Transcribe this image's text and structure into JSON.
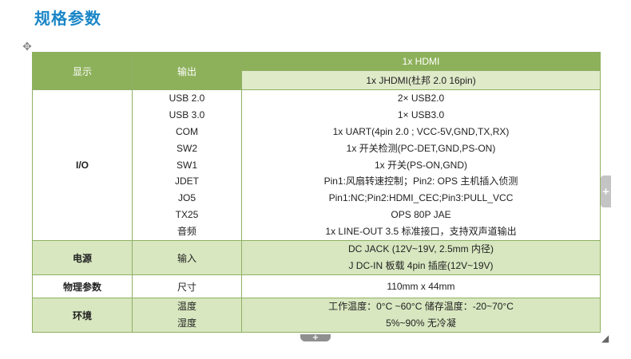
{
  "page_title": "规格参数",
  "table": {
    "display": {
      "label": "显示",
      "sub": "输出",
      "values": [
        "1x HDMI",
        "1x JHDMI(杜邦 2.0 16pin)"
      ]
    },
    "io": {
      "label": "I/O",
      "rows": [
        {
          "name": "USB 2.0",
          "value": "2× USB2.0"
        },
        {
          "name": "USB 3.0",
          "value": "1× USB3.0"
        },
        {
          "name": "COM",
          "value": "1x UART(4pin 2.0 ; VCC-5V,GND,TX,RX)"
        },
        {
          "name": "SW2",
          "value": "1x 开关检测(PC-DET,GND,PS-ON)"
        },
        {
          "name": "SW1",
          "value": "1x 开关(PS-ON,GND)"
        },
        {
          "name": "JDET",
          "value": "Pin1:风扇转速控制；Pin2: OPS 主机插入侦测"
        },
        {
          "name": "JO5",
          "value": "Pin1:NC;Pin2:HDMI_CEC;Pin3:PULL_VCC"
        },
        {
          "name": "TX25",
          "value": "OPS 80P JAE"
        },
        {
          "name": "音频",
          "value": "1x LINE-OUT 3.5 标准接口，支持双声道输出"
        }
      ]
    },
    "power": {
      "label": "电源",
      "sub": "输入",
      "values": [
        "DC JACK (12V~19V, 2.5mm 内径)",
        "J DC-IN 板载 4pin 插座(12V~19V)"
      ]
    },
    "physical": {
      "label": "物理参数",
      "sub": "尺寸",
      "value": "110mm x 44mm"
    },
    "environment": {
      "label": "环境",
      "rows": [
        {
          "name": "温度",
          "value": "工作温度：0°C ~60°C 储存温度：-20~70°C"
        },
        {
          "name": "湿度",
          "value": "5%~90% 无冷凝"
        }
      ]
    }
  },
  "controls": {
    "side_plus": "+",
    "bottom_plus": "+"
  },
  "colors": {
    "title": "#1a86c7",
    "header_bg": "#8db15a",
    "sub_bg": "#dfeac9",
    "border": "#8fb063"
  }
}
